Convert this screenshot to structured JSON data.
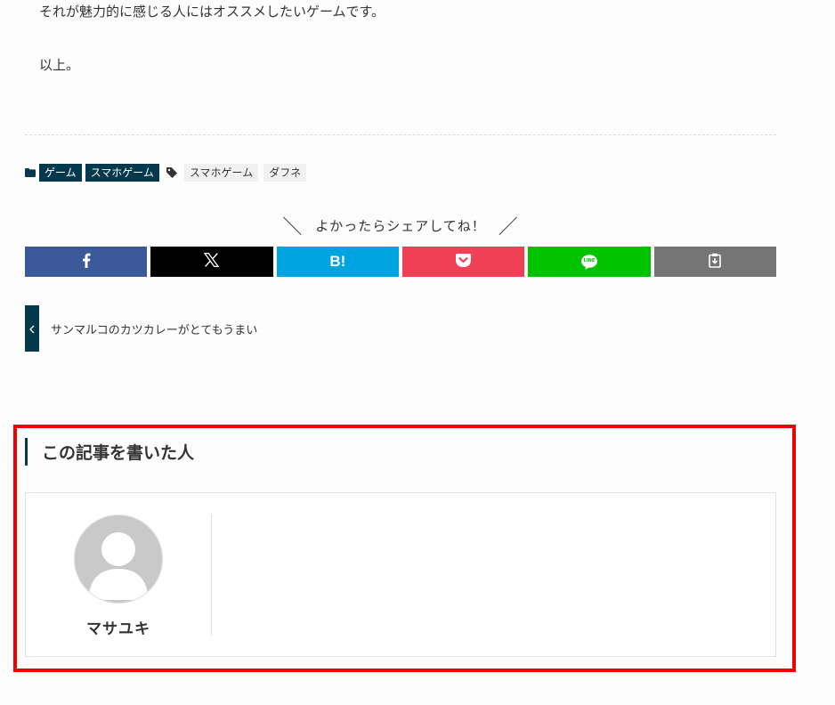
{
  "article": {
    "last_paragraph": "それが魅力的に感じる人にはオススメしたいゲームです。",
    "closing": "以上。"
  },
  "meta": {
    "categories": [
      "ゲーム",
      "スマホゲーム"
    ],
    "tags": [
      "スマホゲーム",
      "ダフネ"
    ],
    "folder_icon": "folder-icon",
    "tag_icon": "tag-icon"
  },
  "share": {
    "heading": "よかったらシェアしてね！",
    "slash_left": "＼",
    "slash_right": "／",
    "buttons": [
      {
        "name": "facebook",
        "icon": "facebook-icon",
        "color": "#3b5998"
      },
      {
        "name": "x",
        "icon": "x-icon",
        "color": "#000000"
      },
      {
        "name": "hatena",
        "icon": "hatena-bookmark-icon",
        "label": "B!",
        "color": "#00a4de"
      },
      {
        "name": "pocket",
        "icon": "pocket-icon",
        "color": "#ef4056"
      },
      {
        "name": "line",
        "icon": "line-icon",
        "label": "LINE",
        "color": "#00c300"
      },
      {
        "name": "copy",
        "icon": "clipboard-icon",
        "color": "#757575"
      }
    ]
  },
  "pager": {
    "prev_title": "サンマルコのカツカレーがとてもうまい",
    "prev_icon": "chevron-left-icon"
  },
  "author": {
    "heading": "この記事を書いた人",
    "name": "マサユキ",
    "avatar_icon": "default-avatar-icon"
  },
  "colors": {
    "accent": "#04384c",
    "highlight": "#f00000"
  }
}
